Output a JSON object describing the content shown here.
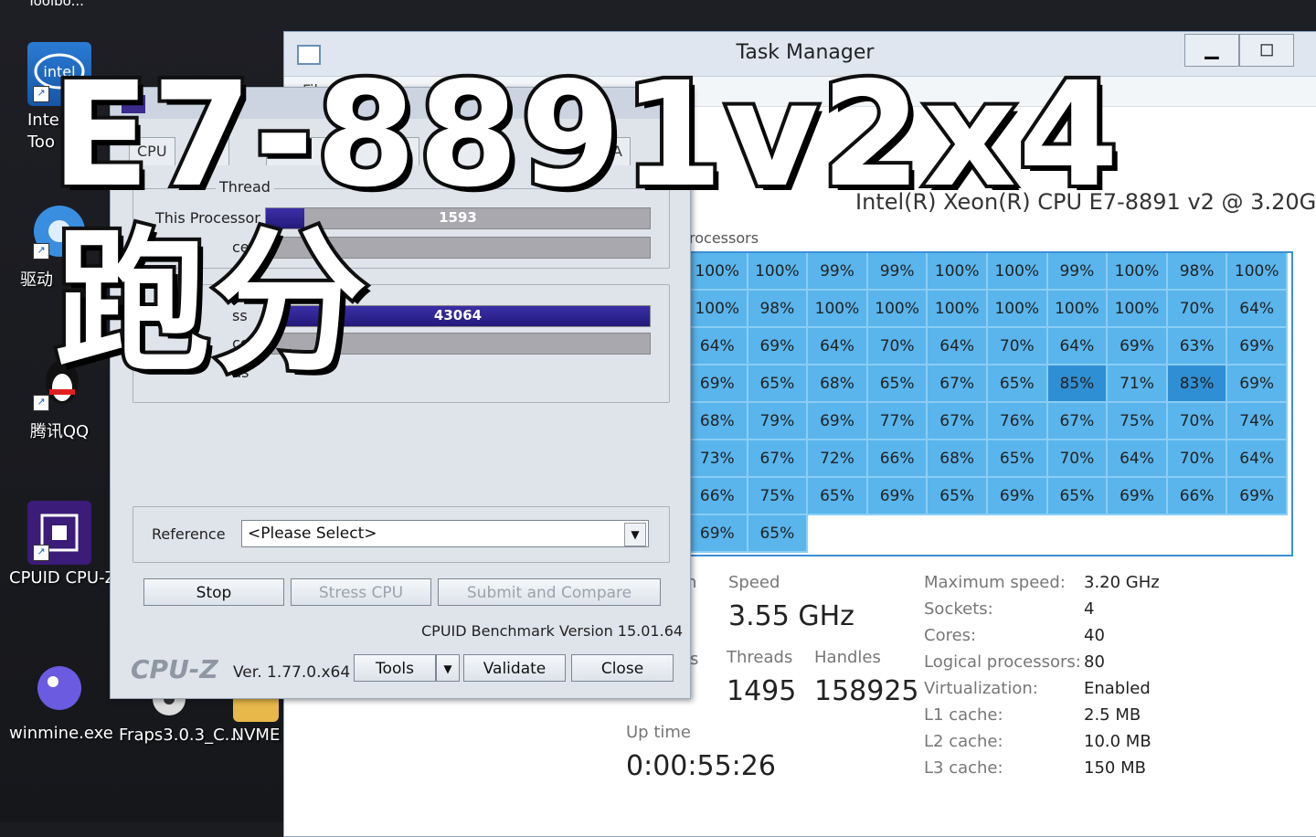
{
  "desktop": {
    "top_text": "Toolbo...",
    "icons": [
      {
        "label": "Inte Too",
        "icon": "intel-icon"
      },
      {
        "label": "驱动",
        "icon": "driver-gear-icon"
      },
      {
        "label": "腾讯QQ",
        "icon": "qq-penguin-icon"
      },
      {
        "label": "CPUID CPU-Z",
        "icon": "cpuz-chip-icon"
      },
      {
        "label": "winmine.exe",
        "icon": "winmine-icon"
      },
      {
        "label": "Fraps3.0.3_C...",
        "icon": "fraps-icon"
      },
      {
        "label": "NVME",
        "icon": "folder-icon"
      }
    ]
  },
  "overlay": {
    "line1": "E7-8891v2x4",
    "line2": "跑分"
  },
  "task_manager": {
    "title": "Task Manager",
    "menu_text": "File  O",
    "min_glyph": "▁",
    "max_glyph": "◻",
    "close_glyph": "×",
    "cpu_name": "Intel(R) Xeon(R) CPU E7-8891 v2 @ 3.20GHz",
    "lp_label": "rocessors",
    "utilization": [
      [
        "100%",
        "100%",
        "99%",
        "99%",
        "100%",
        "100%",
        "99%",
        "100%",
        "98%",
        "100%"
      ],
      [
        "100%",
        "98%",
        "100%",
        "100%",
        "100%",
        "100%",
        "100%",
        "100%",
        "70%",
        "64%"
      ],
      [
        "64%",
        "69%",
        "64%",
        "70%",
        "64%",
        "70%",
        "64%",
        "69%",
        "63%",
        "69%"
      ],
      [
        "69%",
        "65%",
        "68%",
        "65%",
        "67%",
        "65%",
        "85%",
        "71%",
        "83%",
        "69%"
      ],
      [
        "68%",
        "79%",
        "69%",
        "77%",
        "67%",
        "76%",
        "67%",
        "75%",
        "70%",
        "74%"
      ],
      [
        "73%",
        "67%",
        "72%",
        "66%",
        "68%",
        "65%",
        "70%",
        "64%",
        "70%",
        "64%"
      ],
      [
        "66%",
        "75%",
        "65%",
        "69%",
        "65%",
        "69%",
        "65%",
        "69%",
        "66%",
        "69%"
      ],
      [
        "69%",
        "65%"
      ]
    ],
    "speed_label": "Speed",
    "speed_value": "3.55 GHz",
    "threads_label": "Threads",
    "threads_value": "1495",
    "handles_label": "Handles",
    "handles_value": "158925",
    "uptime_label": "Up time",
    "uptime_value": "0:00:55:26",
    "partial_n": "n",
    "partial_s": "s",
    "specs": [
      {
        "k": "Maximum speed:",
        "v": "3.20 GHz"
      },
      {
        "k": "Sockets:",
        "v": "4"
      },
      {
        "k": "Cores:",
        "v": "40"
      },
      {
        "k": "Logical processors:",
        "v": "80"
      },
      {
        "k": "Virtualization:",
        "v": "Enabled"
      },
      {
        "k": "L1 cache:",
        "v": "2.5 MB"
      },
      {
        "k": "L2 cache:",
        "v": "10.0 MB"
      },
      {
        "k": "L3 cache:",
        "v": "150 MB"
      }
    ]
  },
  "cpuz": {
    "tabs": [
      "CPU",
      "es",
      "",
      "",
      "",
      "A"
    ],
    "close_glyph": "×",
    "single_group_title": "Thread",
    "this_processor_label": "This Processor",
    "reference_short": "ce",
    "single_score": "1593",
    "single_fraction": 0.1,
    "multi_label_short": "ss",
    "reference_short2": "ce",
    "threads_short": "ds",
    "multi_score": "43064",
    "multi_fraction": 1.0,
    "reference_label": "Reference",
    "reference_select": "<Please Select>",
    "stop_label": "Stop",
    "stress_label": "Stress CPU",
    "submit_label": "Submit and Compare",
    "version_line": "CPUID Benchmark Version 15.01.64",
    "brand": "CPU-Z",
    "version": "Ver. 1.77.0.x64",
    "tools_label": "Tools",
    "dropdown_glyph": "▼",
    "validate_label": "Validate",
    "close_label": "Close"
  }
}
